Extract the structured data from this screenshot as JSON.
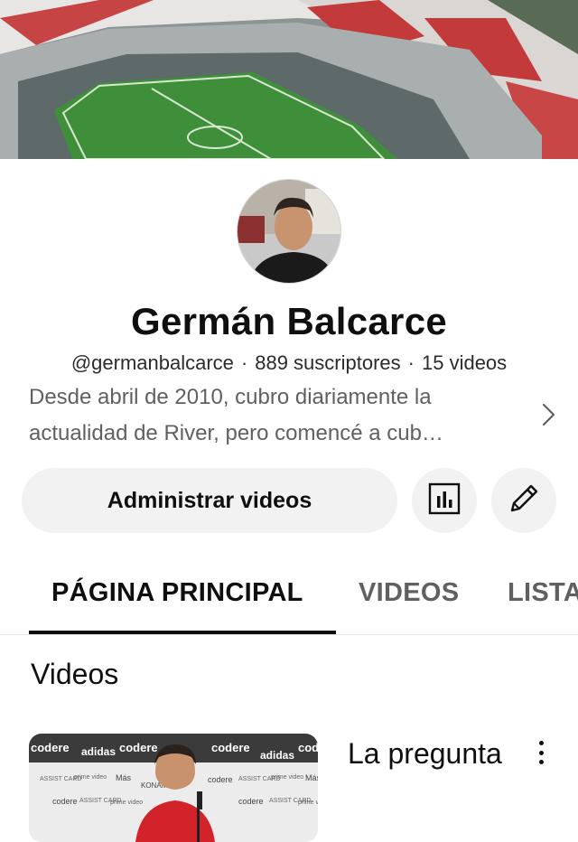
{
  "channel": {
    "name": "Germán Balcarce",
    "handle": "@germanbalcarce",
    "subscribers": "889 suscriptores",
    "video_count": "15 videos",
    "separator": "·",
    "description_line1": "Desde abril de 2010, cubro diariamente la",
    "description_line2": "actualidad de River, pero comencé a cub…"
  },
  "actions": {
    "manage_videos": "Administrar videos",
    "analytics_icon": "bar-chart-icon",
    "edit_icon": "pencil-icon"
  },
  "tabs": [
    {
      "label": "PÁGINA PRINCIPAL",
      "active": true
    },
    {
      "label": "VIDEOS",
      "active": false
    },
    {
      "label": "LISTAS",
      "active": false
    }
  ],
  "section": {
    "title": "Videos"
  },
  "video": {
    "title": "La pregunta"
  },
  "thumbnail_sponsors": [
    "codere",
    "adidas",
    "ASSIST CARD",
    "prime video",
    "Más",
    "KONAMI"
  ],
  "colors": {
    "text": "#0f0f0f",
    "secondary_text": "#606060",
    "button_bg": "#f2f2f2",
    "pitch": "#3f8f3a"
  }
}
